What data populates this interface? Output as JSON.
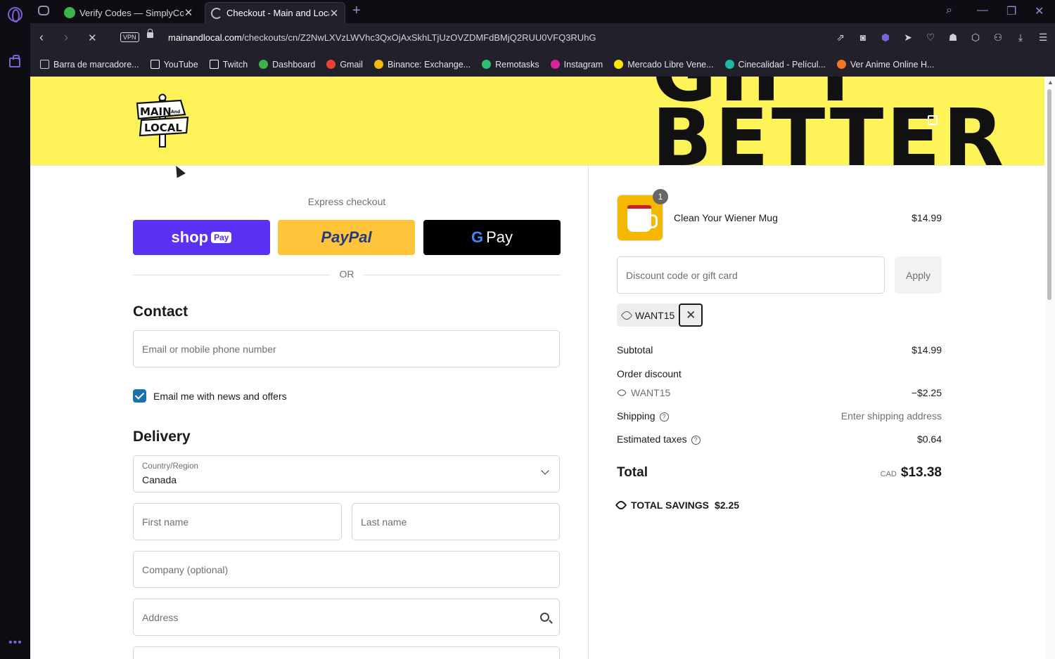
{
  "browser": {
    "tabs": [
      {
        "label": "Verify Codes — SimplyCodes",
        "active": false
      },
      {
        "label": "Checkout - Main and Local",
        "active": true
      }
    ],
    "url_host": "mainandlocal.com",
    "url_path": "/checkouts/cn/Z2NwLXVzLWVhc3QxOjAxSkhLTjUzOVZDMFdBMjQ2RUU0VFQ3RUhG",
    "vpn_label": "VPN",
    "bookmarks": [
      {
        "label": "Barra de marcadore...",
        "icon": "folder-icon",
        "color": "#cccccc"
      },
      {
        "label": "YouTube",
        "icon": "file-icon",
        "color": "#ffffff"
      },
      {
        "label": "Twitch",
        "icon": "file-icon",
        "color": "#ffffff"
      },
      {
        "label": "Dashboard",
        "icon": "dashboard-icon",
        "color": "#3ab54a"
      },
      {
        "label": "Gmail",
        "icon": "gmail-icon",
        "color": "#ea4335"
      },
      {
        "label": "Binance: Exchange...",
        "icon": "binance-icon",
        "color": "#f0b90b"
      },
      {
        "label": "Remotasks",
        "icon": "remotasks-icon",
        "color": "#2fbf71"
      },
      {
        "label": "Instagram",
        "icon": "instagram-icon",
        "color": "#d6249f"
      },
      {
        "label": "Mercado Libre Vene...",
        "icon": "mercadolibre-icon",
        "color": "#ffe600"
      },
      {
        "label": "Cinecalidad - Películ...",
        "icon": "cinecalidad-icon",
        "color": "#1fb6a6"
      },
      {
        "label": "Ver Anime Online H...",
        "icon": "animeflv-icon",
        "color": "#f47521"
      }
    ]
  },
  "banner": {
    "brand_top": "MAIN",
    "brand_mid": "And",
    "brand_bottom": "LOCAL",
    "slogan_line1": "GIFT",
    "slogan_line2": "BETTER",
    "colors": {
      "banner": "#fef358"
    }
  },
  "checkout": {
    "express_label": "Express checkout",
    "shop_pay": "shop",
    "shop_pay_pill": "Pay",
    "paypal": "PayPal",
    "gpay": "Pay",
    "or_label": "OR",
    "contact_heading": "Contact",
    "email_placeholder": "Email or mobile phone number",
    "newsletter_label": "Email me with news and offers",
    "newsletter_checked": true,
    "delivery_heading": "Delivery",
    "country_label": "Country/Region",
    "country_value": "Canada",
    "first_name_placeholder": "First name",
    "last_name_placeholder": "Last name",
    "company_placeholder": "Company (optional)",
    "address_placeholder": "Address",
    "colors": {
      "shop_pay": "#5a31f4",
      "paypal": "#ffc439",
      "checkbox": "#1773b0"
    }
  },
  "summary": {
    "item": {
      "name": "Clean Your Wiener Mug",
      "quantity": "1",
      "price": "$14.99"
    },
    "discount_placeholder": "Discount code or gift card",
    "apply_label": "Apply",
    "applied_code": "WANT15",
    "subtotal_label": "Subtotal",
    "subtotal_value": "$14.99",
    "order_discount_label": "Order discount",
    "discount_code": "WANT15",
    "discount_value": "−$2.25",
    "shipping_label": "Shipping",
    "shipping_value": "Enter shipping address",
    "taxes_label": "Estimated taxes",
    "taxes_value": "$0.64",
    "total_label": "Total",
    "currency": "CAD",
    "total_value": "$13.38",
    "savings_label": "TOTAL SAVINGS",
    "savings_value": "$2.25"
  }
}
